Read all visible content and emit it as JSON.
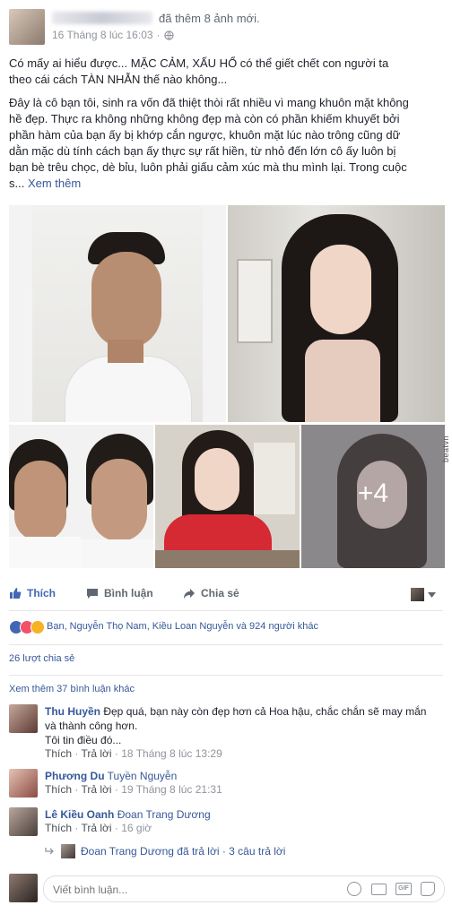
{
  "post": {
    "author_blurred": "",
    "action_text": "đã thêm 8 ảnh mới.",
    "timestamp": "16 Tháng 8 lúc 16:03",
    "privacy_icon": "globe-icon",
    "paragraph1_line1": "Có mấy ai hiểu được... MẶC CẢM, XẤU HỔ có thể giết chết con người ta",
    "paragraph1_line2": "theo cái cách TÀN NHẪN thế nào không...",
    "paragraph2_line1": "Đây là cô bạn tôi, sinh ra vốn đã thiệt thòi rất nhiều vì mang khuôn mặt không",
    "paragraph2_line2": "hề đẹp. Thực ra không những không đẹp mà còn có phần khiếm khuyết bởi",
    "paragraph2_line3": "phần hàm của bạn ấy bị khớp cắn ngược, khuôn mặt lúc nào trông cũng dữ",
    "paragraph2_line4": "dằn mặc dù tính cách bạn ấy thực sự rất hiền, từ nhỏ đến lớn cô ấy luôn bị",
    "paragraph2_line5": "bạn bè trêu chọc, dè bỉu, luôn phải giấu cảm xúc mà thu mình lại. Trong cuộc",
    "paragraph2_line6_start": "s...",
    "see_more": "Xem thêm"
  },
  "photos": {
    "more_count": "+4",
    "watermark": "beatvn"
  },
  "actions": {
    "like": "Thích",
    "comment": "Bình luận",
    "share": "Chia sẻ"
  },
  "reactions": {
    "summary": "Bạn, Nguyễn Thọ Nam, Kiều Loan Nguyễn và 924 người khác",
    "colors": {
      "like": "#4267b2",
      "love": "#f25268",
      "wow": "#f7b125"
    }
  },
  "shares": "26 lượt chia sẻ",
  "comments": {
    "view_more": "Xem thêm 37 bình luận khác",
    "items": [
      {
        "name": "Thu Huyền",
        "text_line1": "Đẹp quá, bạn này còn đẹp hơn cả Hoa hậu, chắc chắn sẽ may mắn",
        "text_line2": "và thành công hơn.",
        "text_line3": "Tôi tin điều đó...",
        "like": "Thích",
        "reply": "Trả lời",
        "time": "18 Tháng 8 lúc 13:29"
      },
      {
        "name": "Phương Du",
        "tag": "Tuyền Nguyễn",
        "like": "Thích",
        "reply": "Trả lời",
        "time": "19 Tháng 8 lúc 21:31"
      },
      {
        "name": "Lê Kiều Oanh",
        "tag": "Đoan Trang Dương",
        "like": "Thích",
        "reply": "Trả lời",
        "time": "16 giờ"
      }
    ],
    "replies_summary": "Đoan Trang Dương đã trả lời · 3 câu trả lời"
  },
  "composer": {
    "placeholder": "Viết bình luận..."
  }
}
